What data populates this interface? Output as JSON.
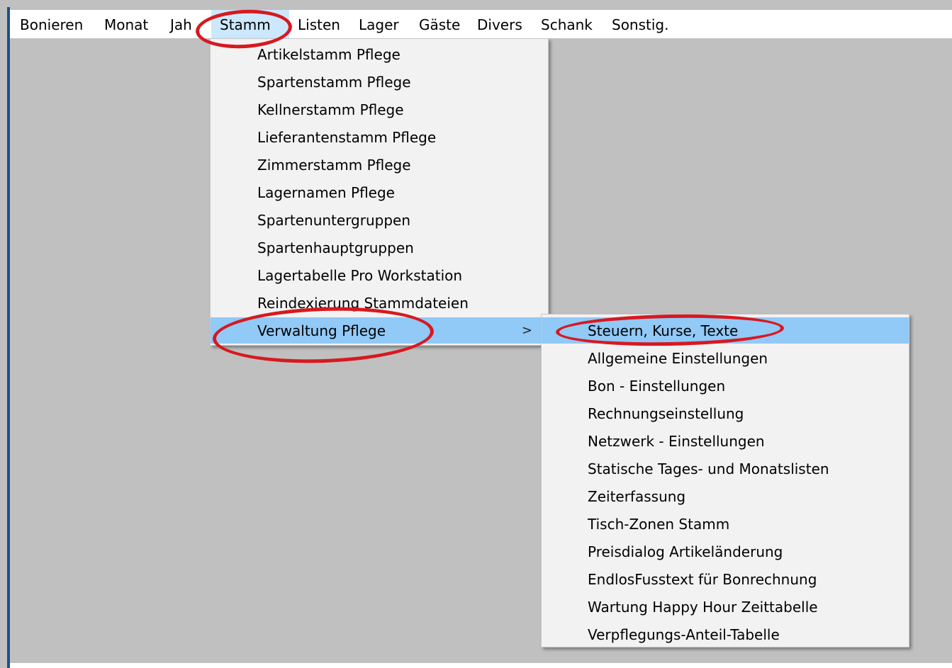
{
  "menubar": {
    "items": [
      {
        "label": "Bonieren"
      },
      {
        "label": "Monat"
      },
      {
        "label": "Jah"
      },
      {
        "label": "Stamm"
      },
      {
        "label": "Listen"
      },
      {
        "label": "Lager"
      },
      {
        "label": "Gäste"
      },
      {
        "label": "Divers"
      },
      {
        "label": "Schank"
      },
      {
        "label": "Sonstig."
      }
    ],
    "active": "Stamm"
  },
  "stamm_menu": {
    "items": [
      {
        "label": "Artikelstamm Pflege"
      },
      {
        "label": "Spartenstamm Pflege"
      },
      {
        "label": "Kellnerstamm Pflege"
      },
      {
        "label": "Lieferantenstamm Pflege"
      },
      {
        "label": "Zimmerstamm Pflege"
      },
      {
        "label": "Lagernamen Pflege"
      },
      {
        "label": "Spartenuntergruppen"
      },
      {
        "label": "Spartenhauptgruppen"
      },
      {
        "label": "Lagertabelle Pro Workstation"
      },
      {
        "label": "Reindexierung Stammdateien"
      },
      {
        "label": "Verwaltung Pflege",
        "submenu_arrow": ">"
      }
    ],
    "highlighted": "Verwaltung Pflege"
  },
  "verwaltung_submenu": {
    "items": [
      {
        "label": "Steuern, Kurse, Texte"
      },
      {
        "label": "Allgemeine Einstellungen"
      },
      {
        "label": "Bon - Einstellungen"
      },
      {
        "label": "Rechnungseinstellung"
      },
      {
        "label": "Netzwerk - Einstellungen"
      },
      {
        "label": "Statische Tages- und Monatslisten"
      },
      {
        "label": "Zeiterfassung"
      },
      {
        "label": "Tisch-Zonen Stamm"
      },
      {
        "label": "Preisdialog Artikeländerung"
      },
      {
        "label": "EndlosFusstext für Bonrechnung"
      },
      {
        "label": "Wartung Happy Hour Zeittabelle"
      },
      {
        "label": "Verpflegungs-Anteil-Tabelle"
      }
    ],
    "highlighted": "Steuern, Kurse, Texte"
  },
  "colors": {
    "desktop": "#c0c0c0",
    "menu_background": "#f2f2f2",
    "highlight": "#91c9f7",
    "annotation_red": "#d7191f"
  }
}
